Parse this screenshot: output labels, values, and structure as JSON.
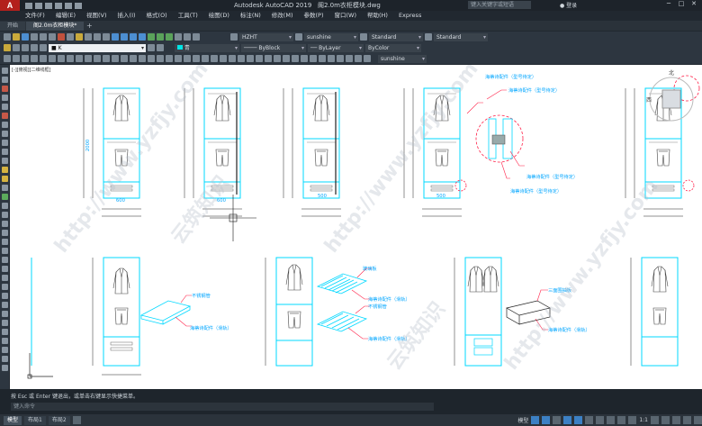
{
  "window": {
    "app_title": "Autodesk AutoCAD 2019",
    "file_name": "阁2.0m衣柜模块.dwg",
    "search_placeholder": "键入关键字或短语",
    "login_label": "登录"
  },
  "menu": [
    "文件(F)",
    "编辑(E)",
    "视图(V)",
    "插入(I)",
    "格式(O)",
    "工具(T)",
    "绘图(D)",
    "标注(N)",
    "修改(M)",
    "参数(P)",
    "窗口(W)",
    "帮助(H)",
    "Express"
  ],
  "tabs": [
    {
      "label": "开始"
    },
    {
      "label": "阁2.0m衣柜模块*"
    }
  ],
  "toolbar": {
    "layer": "K",
    "color": "青",
    "linetype1": "ByBlock",
    "linetype2": "ByLayer",
    "lineweight": "ByColor",
    "text_style": "HZHT",
    "dim_style": "sunshine",
    "table_style": "Standard",
    "multileader_style": "Standard",
    "visual_style": "sunshine"
  },
  "viewport_label": "[-][俯视][二维线框]",
  "view_cube": {
    "north": "北",
    "west": "西"
  },
  "annotations": {
    "a1": "海蒂诗配件（型号待定）",
    "a2": "海蒂诗配件（型号待定）",
    "a3": "海蒂诗配件（型号待定）",
    "a4": "海蒂诗配件（型号待定）",
    "b1": "不锈钢管",
    "b2": "海蒂诗配件（滑轨）",
    "c1": "玻璃板",
    "c2": "海蒂诗配件（滑轨）",
    "c3": "不锈钢管",
    "c4": "海蒂诗配件（滑轨）",
    "d1": "三面围抽板",
    "d2": "海蒂诗配件（滑轨）"
  },
  "dims": {
    "w1": "600",
    "w2": "500",
    "h1": "2000"
  },
  "watermark": [
    "http://www.yzfjy.com",
    "云筑知识"
  ],
  "command": {
    "history": "按 Esc 或 Enter 键退出，或单击右键显示快捷菜单。",
    "prompt": "键入命令"
  },
  "status": {
    "tabs": [
      "模型",
      "布局1",
      "布局2"
    ],
    "model_label": "模型",
    "scale": "1:1"
  }
}
